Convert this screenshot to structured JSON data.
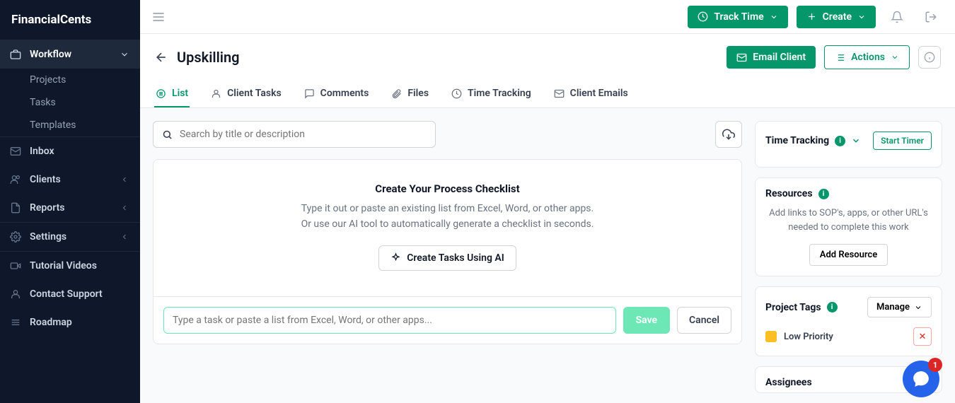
{
  "brand": "FinancialCents",
  "sidebar": {
    "workflow": {
      "label": "Workflow",
      "projects": "Projects",
      "tasks": "Tasks",
      "templates": "Templates"
    },
    "inbox": "Inbox",
    "clients": "Clients",
    "reports": "Reports",
    "settings": "Settings",
    "tutorial": "Tutorial Videos",
    "support": "Contact Support",
    "roadmap": "Roadmap"
  },
  "topbar": {
    "track_time": "Track Time",
    "create": "Create"
  },
  "page": {
    "title": "Upskilling",
    "email_client": "Email Client",
    "actions": "Actions"
  },
  "tabs": {
    "list": "List",
    "client_tasks": "Client Tasks",
    "comments": "Comments",
    "files": "Files",
    "time_tracking": "Time Tracking",
    "client_emails": "Client Emails"
  },
  "search": {
    "placeholder": "Search by title or description"
  },
  "checklist": {
    "title": "Create Your Process Checklist",
    "line1": "Type it out or paste an existing list from Excel, Word, or other apps.",
    "line2": "Or use our AI tool to automatically generate a checklist in seconds.",
    "ai_button": "Create Tasks Using AI"
  },
  "task_input": {
    "placeholder": "Type a task or paste a list from Excel, Word, or other apps...",
    "save": "Save",
    "cancel": "Cancel"
  },
  "time_tracking_card": {
    "title": "Time Tracking",
    "start": "Start Timer"
  },
  "resources": {
    "title": "Resources",
    "desc": "Add links to SOP's, apps, or other URL's needed to complete this work",
    "add": "Add Resource"
  },
  "tags": {
    "title": "Project Tags",
    "manage": "Manage",
    "tag1": "Low Priority",
    "tag1_color": "#fbbf24"
  },
  "assignees": {
    "title": "Assignees"
  },
  "chat_badge": "1"
}
